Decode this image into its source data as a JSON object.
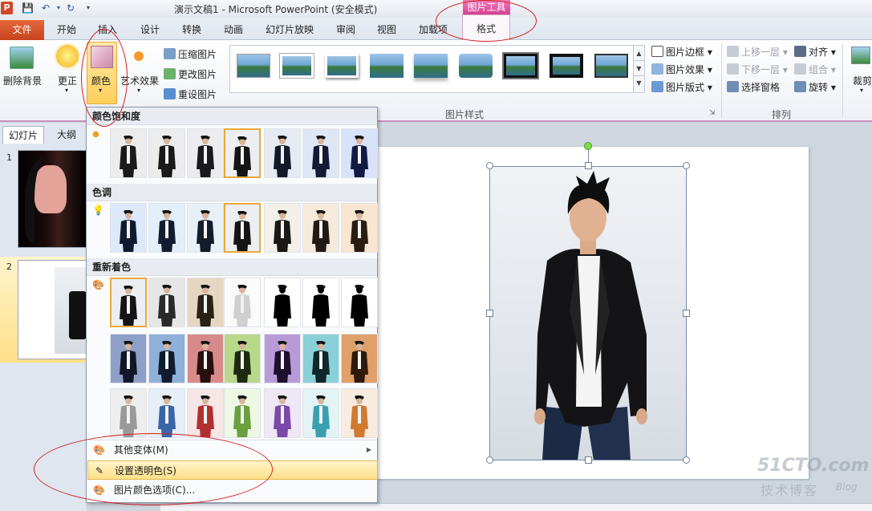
{
  "app": {
    "title": "演示文稿1 - Microsoft PowerPoint (安全模式)",
    "logo_letter": "P",
    "context_tab_header": "图片工具"
  },
  "tabs": {
    "file": "文件",
    "home": "开始",
    "insert": "插入",
    "design": "设计",
    "transitions": "转换",
    "animations": "动画",
    "slideshow": "幻灯片放映",
    "review": "审阅",
    "view": "视图",
    "addins": "加载项",
    "format": "格式"
  },
  "ribbon": {
    "remove_bg": "删除背景",
    "corrections": "更正",
    "color": "颜色",
    "artistic": "艺术效果",
    "compress": "压缩图片",
    "change_pic": "更改图片",
    "reset_pic": "重设图片",
    "pic_border": "图片边框",
    "pic_effects": "图片效果",
    "pic_layout": "图片版式",
    "bring_forward": "上移一层",
    "send_backward": "下移一层",
    "selection_pane": "选择窗格",
    "align": "对齐",
    "group": "组合",
    "rotate": "旋转",
    "crop": "裁剪",
    "group_pic_styles": "图片样式",
    "group_arrange": "排列"
  },
  "panel": {
    "tab_slides": "幻灯片",
    "tab_outline": "大纲",
    "slide_numbers": [
      "1",
      "2"
    ]
  },
  "color_menu": {
    "section_saturation": "颜色饱和度",
    "section_tone": "色调",
    "section_recolor": "重新着色",
    "more_variations": "其他变体(M)",
    "set_transparent": "设置透明色(S)",
    "color_options": "图片颜色选项(C)..."
  },
  "watermark": {
    "line1": "51CTO.com",
    "line2": "技术博客",
    "line3": "Blog"
  },
  "colors": {
    "file_tab": "#d24726",
    "context_pink": "#d43d91",
    "highlight": "#ffe08a",
    "annotation_red": "#d11f1f"
  }
}
